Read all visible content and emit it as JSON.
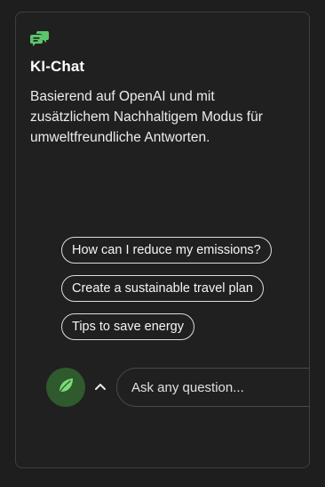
{
  "card": {
    "icon": "chat-bubbles-icon",
    "title": "KI-Chat",
    "description": "Basierend auf OpenAI und mit zusätzlichem Nachhaltigem Modus für umweltfreundliche Antworten."
  },
  "suggestions": [
    {
      "label": "How can I reduce my emissions?"
    },
    {
      "label": "Create a sustainable travel plan"
    },
    {
      "label": "Tips to save energy"
    }
  ],
  "composer": {
    "mode_icon": "leaf-icon",
    "toggle_icon": "chevron-up-icon",
    "placeholder": "Ask any question...",
    "value": ""
  },
  "colors": {
    "background": "#1e1e1e",
    "card_background": "#202020",
    "accent_green": "#5cc46a",
    "leaf_button": "#2f5a2d",
    "text": "#f2f2f2"
  }
}
